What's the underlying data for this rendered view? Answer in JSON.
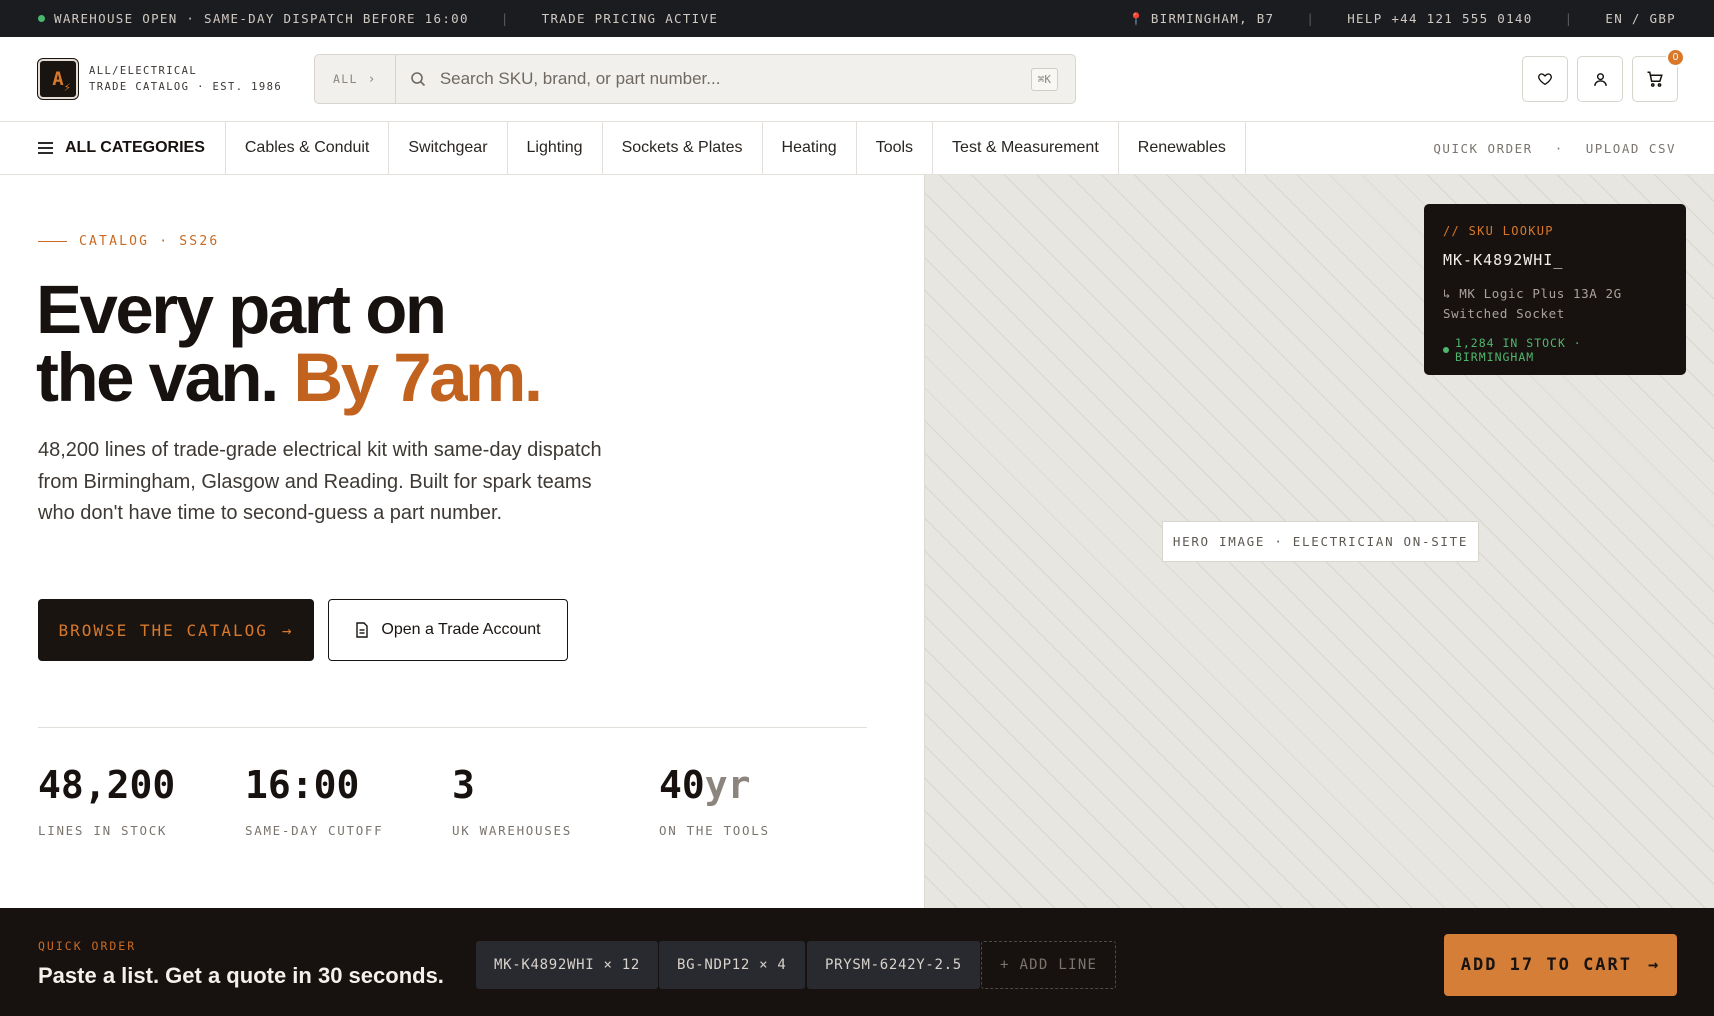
{
  "topbar": {
    "status": "WAREHOUSE OPEN · SAME-DAY DISPATCH BEFORE 16:00",
    "pricing": "TRADE PRICING ACTIVE",
    "location": "BIRMINGHAM, B7",
    "help": "HELP +44 121 555 0140",
    "locale": "EN / GBP",
    "status_color": "#49b86d"
  },
  "brand": {
    "logo_letter": "A",
    "name": "ALL/ELECTRICAL",
    "tagline": "TRADE CATALOG · EST. 1986"
  },
  "search": {
    "scope": "ALL",
    "placeholder": "Search SKU, brand, or part number...",
    "shortcut": "⌘K"
  },
  "header_actions": {
    "wishlist_icon": "heart-icon",
    "account_icon": "user-icon",
    "cart_icon": "cart-icon",
    "cart_count": "0"
  },
  "nav": {
    "all_categories": "ALL CATEGORIES",
    "items": [
      "Cables & Conduit",
      "Switchgear",
      "Lighting",
      "Sockets & Plates",
      "Heating",
      "Tools",
      "Test & Measurement",
      "Renewables"
    ],
    "quick_order": "QUICK ORDER",
    "upload_csv": "UPLOAD CSV"
  },
  "hero": {
    "eyebrow": "CATALOG · SS26",
    "headline_line1": "Every part on",
    "headline_line2": "the van.",
    "headline_accent": "By 7am.",
    "lede": "48,200 lines of trade-grade electrical kit with same-day dispatch from Birmingham, Glasgow and Reading. Built for spark teams who don't have time to second-guess a part number.",
    "primary_cta": "BROWSE THE CATALOG",
    "secondary_cta": "Open a Trade Account",
    "image_label": "HERO IMAGE · ELECTRICIAN ON-SITE",
    "accent_color": "#c2621f"
  },
  "stats": [
    {
      "value": "48,200",
      "unit": "",
      "label": "LINES IN STOCK"
    },
    {
      "value": "16:00",
      "unit": "",
      "label": "SAME-DAY CUTOFF"
    },
    {
      "value": "3",
      "unit": "",
      "label": "UK WAREHOUSES"
    },
    {
      "value": "40",
      "unit": "yr",
      "label": "ON THE TOOLS"
    }
  ],
  "sku_lookup": {
    "title": "// SKU LOOKUP",
    "query": "MK-K4892WHI_",
    "result_line1": "↳ MK Logic Plus 13A 2G",
    "result_line2": "Switched Socket",
    "stock": "1,284 IN STOCK · BIRMINGHAM"
  },
  "quick_order": {
    "eyebrow": "QUICK ORDER",
    "title": "Paste a list. Get a quote in 30 seconds.",
    "lines": [
      "MK-K4892WHI × 12",
      "BG-NDP12 × 4",
      "PRYSM-6242Y-2.5"
    ],
    "add_line": "+ ADD LINE",
    "cta": "ADD 17 TO CART",
    "cta_color": "#d57e38"
  }
}
